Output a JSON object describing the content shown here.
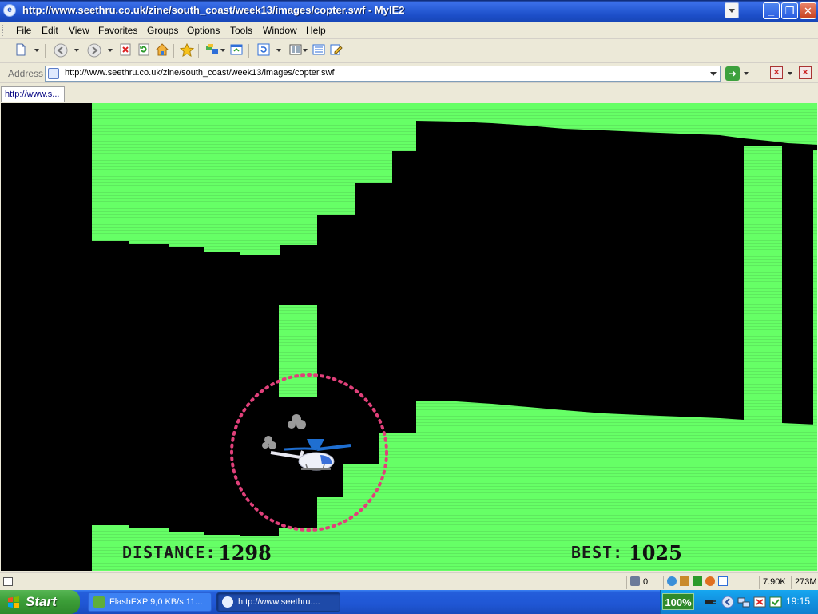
{
  "window": {
    "title": "http://www.seethru.co.uk/zine/south_coast/week13/images/copter.swf - MyIE2",
    "app_icon": "myie2-icon",
    "buttons": [
      "minimize-icon",
      "maximize-icon",
      "close-icon"
    ]
  },
  "menu": [
    "File",
    "Edit",
    "View",
    "Favorites",
    "Groups",
    "Options",
    "Tools",
    "Window",
    "Help"
  ],
  "toolbar": {
    "icons": [
      "new-page-icon",
      "back-icon",
      "forward-icon",
      "stop-icon",
      "refresh-icon",
      "home-icon",
      "favorites-star-icon",
      "collector-icon",
      "restore-icon",
      "undo-icon",
      "layout-icon",
      "list-icon",
      "edit-icon"
    ]
  },
  "address": {
    "label": "Address",
    "url": "http://www.seethru.co.uk/zine/south_coast/week13/images/copter.swf"
  },
  "tabs": [
    {
      "label": "http://www.s...",
      "active": true
    }
  ],
  "game": {
    "distance_label": "DISTANCE:",
    "distance_value": "1298",
    "best_label": "BEST:",
    "best_value": "1025",
    "colors": {
      "cave": "#66ff66",
      "background": "#000000",
      "highlight_ring": "#e0407a",
      "copter": "#1f6fd1"
    }
  },
  "statusbar": {
    "text": "",
    "popup_count": "0",
    "download_speed": "7.90K",
    "memory": "273M"
  },
  "taskbar": {
    "start_label": "Start",
    "tasks": [
      {
        "label": "FlashFXP 9,0 KB/s 11...",
        "active": false
      },
      {
        "label": "http://www.seethru....",
        "active": true
      }
    ],
    "tray": {
      "battery": "100%",
      "clock": "19:15",
      "icons": [
        "power-plug-icon",
        "back-arrow-icon",
        "network-icon",
        "security-icon",
        "messenger-icon"
      ]
    }
  }
}
